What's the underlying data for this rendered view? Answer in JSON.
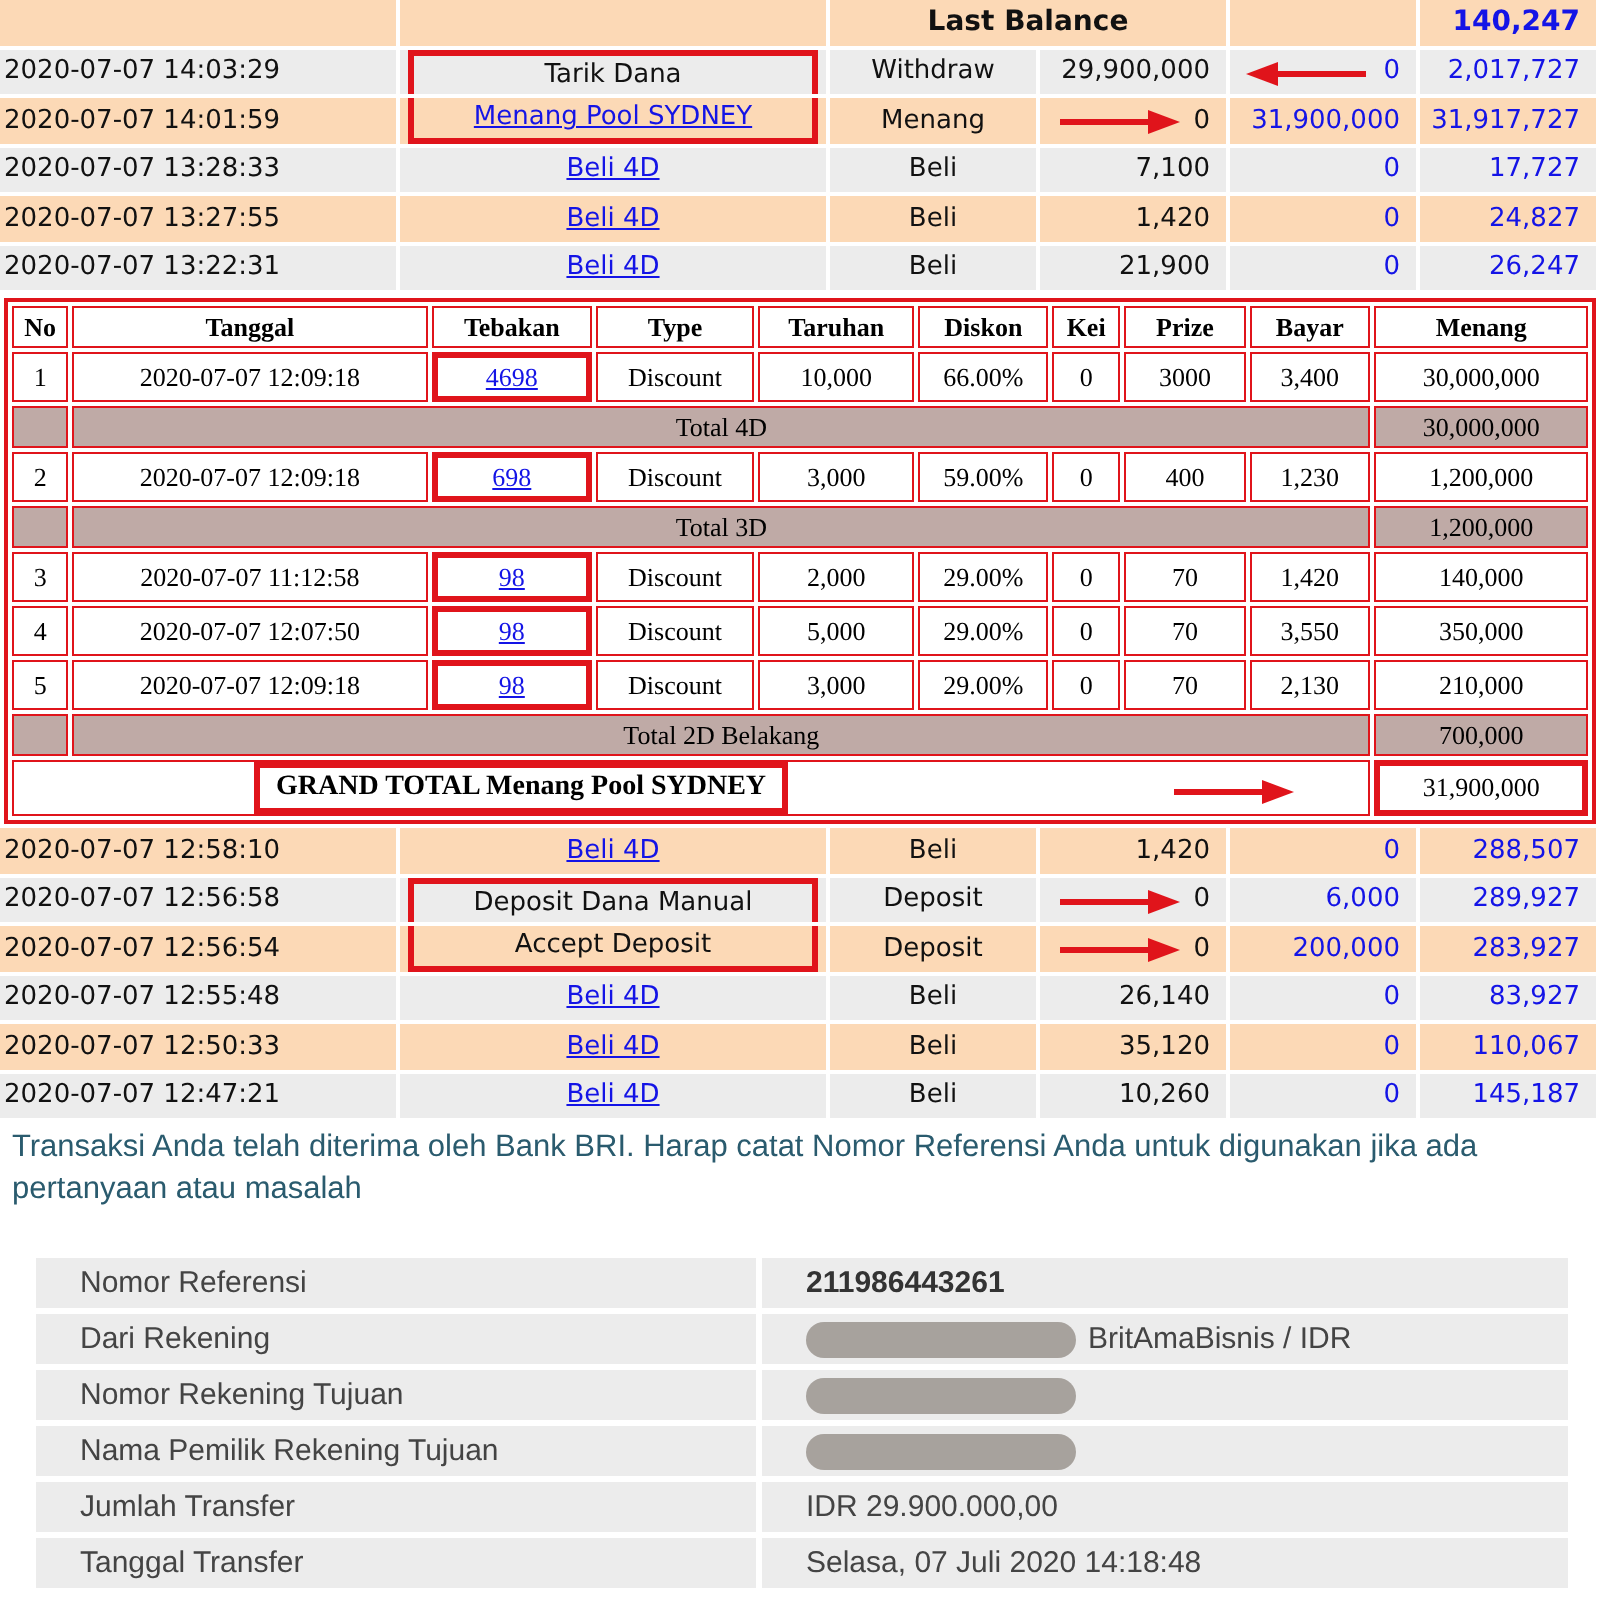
{
  "ledger_top": {
    "header": {
      "label": "Last Balance",
      "balance": "140,247"
    },
    "rows": [
      {
        "time": "2020-07-07 14:03:29",
        "kind": "text",
        "description": "Tarik Dana",
        "boxed": true,
        "type": "Withdraw",
        "debit": "29,900,000",
        "credit": "0",
        "balance": "2,017,727",
        "left_arrow": true,
        "right_arrow": false
      },
      {
        "time": "2020-07-07 14:01:59",
        "kind": "link",
        "description": "Menang Pool SYDNEY",
        "boxed": true,
        "type": "Menang",
        "debit": "0",
        "credit": "31,900,000",
        "balance": "31,917,727",
        "left_arrow": false,
        "right_arrow": true
      },
      {
        "time": "2020-07-07 13:28:33",
        "kind": "link",
        "description": "Beli 4D",
        "boxed": false,
        "type": "Beli",
        "debit": "7,100",
        "credit": "0",
        "balance": "17,727",
        "left_arrow": false,
        "right_arrow": false
      },
      {
        "time": "2020-07-07 13:27:55",
        "kind": "link",
        "description": "Beli 4D",
        "boxed": false,
        "type": "Beli",
        "debit": "1,420",
        "credit": "0",
        "balance": "24,827",
        "left_arrow": false,
        "right_arrow": false
      },
      {
        "time": "2020-07-07 13:22:31",
        "kind": "link",
        "description": "Beli 4D",
        "boxed": false,
        "type": "Beli",
        "debit": "21,900",
        "credit": "0",
        "balance": "26,247",
        "left_arrow": false,
        "right_arrow": false
      }
    ]
  },
  "bets": {
    "columns": [
      "No",
      "Tanggal",
      "Tebakan",
      "Type",
      "Taruhan",
      "Diskon",
      "Kei",
      "Prize",
      "Bayar",
      "Menang"
    ],
    "rows": [
      {
        "kind": "bet",
        "cells": [
          "1",
          "2020-07-07 12:09:18",
          "4698",
          "Discount",
          "10,000",
          "66.00%",
          "0",
          "3000",
          "3,400",
          "30,000,000"
        ]
      },
      {
        "kind": "total",
        "label": "Total 4D",
        "value": "30,000,000"
      },
      {
        "kind": "bet",
        "cells": [
          "2",
          "2020-07-07 12:09:18",
          "698",
          "Discount",
          "3,000",
          "59.00%",
          "0",
          "400",
          "1,230",
          "1,200,000"
        ]
      },
      {
        "kind": "total",
        "label": "Total 3D",
        "value": "1,200,000"
      },
      {
        "kind": "bet",
        "cells": [
          "3",
          "2020-07-07 11:12:58",
          "98",
          "Discount",
          "2,000",
          "29.00%",
          "0",
          "70",
          "1,420",
          "140,000"
        ]
      },
      {
        "kind": "bet",
        "cells": [
          "4",
          "2020-07-07 12:07:50",
          "98",
          "Discount",
          "5,000",
          "29.00%",
          "0",
          "70",
          "3,550",
          "350,000"
        ]
      },
      {
        "kind": "bet",
        "cells": [
          "5",
          "2020-07-07 12:09:18",
          "98",
          "Discount",
          "3,000",
          "29.00%",
          "0",
          "70",
          "2,130",
          "210,000"
        ]
      },
      {
        "kind": "total",
        "label": "Total 2D Belakang",
        "value": "700,000"
      }
    ],
    "grand_total": {
      "label": "GRAND TOTAL  Menang Pool SYDNEY",
      "value": "31,900,000"
    }
  },
  "ledger_bottom": {
    "rows": [
      {
        "time": "2020-07-07 12:58:10",
        "kind": "link",
        "description": "Beli 4D",
        "boxed": false,
        "type": "Beli",
        "debit": "1,420",
        "credit": "0",
        "balance": "288,507",
        "left_arrow": false,
        "right_arrow": false
      },
      {
        "time": "2020-07-07 12:56:58",
        "kind": "text",
        "description": "Deposit Dana Manual",
        "boxed": true,
        "type": "Deposit",
        "debit": "0",
        "credit": "6,000",
        "balance": "289,927",
        "left_arrow": false,
        "right_arrow": true
      },
      {
        "time": "2020-07-07 12:56:54",
        "kind": "text",
        "description": "Accept Deposit",
        "boxed": true,
        "type": "Deposit",
        "debit": "0",
        "credit": "200,000",
        "balance": "283,927",
        "left_arrow": false,
        "right_arrow": true
      },
      {
        "time": "2020-07-07 12:55:48",
        "kind": "link",
        "description": "Beli 4D",
        "boxed": false,
        "type": "Beli",
        "debit": "26,140",
        "credit": "0",
        "balance": "83,927",
        "left_arrow": false,
        "right_arrow": false
      },
      {
        "time": "2020-07-07 12:50:33",
        "kind": "link",
        "description": "Beli 4D",
        "boxed": false,
        "type": "Beli",
        "debit": "35,120",
        "credit": "0",
        "balance": "110,067",
        "left_arrow": false,
        "right_arrow": false
      },
      {
        "time": "2020-07-07 12:47:21",
        "kind": "link",
        "description": "Beli 4D",
        "boxed": false,
        "type": "Beli",
        "debit": "10,260",
        "credit": "0",
        "balance": "145,187",
        "left_arrow": false,
        "right_arrow": false
      }
    ]
  },
  "bank": {
    "message": "Transaksi Anda telah diterima oleh Bank BRI. Harap catat Nomor Referensi Anda untuk digunakan jika ada pertanyaan atau masalah",
    "rows": [
      {
        "label": "Nomor Referensi",
        "value": "211986443261",
        "redacted": false,
        "bold": true
      },
      {
        "label": "Dari Rekening",
        "value": "BritAmaBisnis / IDR",
        "redacted": true,
        "bold": false
      },
      {
        "label": "Nomor Rekening Tujuan",
        "redacted": true
      },
      {
        "label": "Nama Pemilik Rekening Tujuan",
        "redacted": true
      },
      {
        "label": "Jumlah Transfer",
        "value": "IDR 29.900.000,00",
        "redacted": false,
        "bold": false
      },
      {
        "label": "Tanggal Transfer",
        "value": "Selasa, 07 Juli 2020 14:18:48",
        "redacted": false,
        "bold": false
      }
    ]
  }
}
